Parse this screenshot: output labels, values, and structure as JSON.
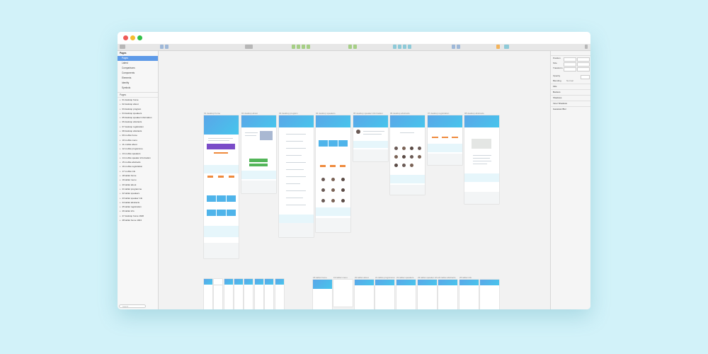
{
  "sidebar": {
    "pages_header": "Pages",
    "pages": [
      "Pages",
      "Latest",
      "Comparisons",
      "Components",
      "Elements",
      "Identity",
      "Symbols"
    ],
    "layers_header": "Pages",
    "layers": [
      "01 desktop home",
      "02 desktop about",
      "03 desktop program",
      "04 desktop speakers",
      "05 desktop speaker information",
      "06 desktop abstracts",
      "07 desktop registration",
      "08 desktop abstracts",
      "09 mobile home",
      "10 mobile menu",
      "11 mobile about",
      "12 mobile programme",
      "13 mobile speakers",
      "14 mobile speaker information",
      "15 mobile abstracts",
      "16 mobile registration",
      "17 mobile info",
      "18 tablet home",
      "19 tablet menu",
      "20 tablet about",
      "21 tablet programme",
      "22 tablet speakers",
      "23 tablet speaker info",
      "24 tablet abstracts",
      "25 tablet registration",
      "26 tablet info",
      "27 desktop home 1920",
      "28 tablet home 1024"
    ],
    "search_placeholder": "Search"
  },
  "artboards_top": [
    "01 desktop home",
    "02 desktop about",
    "03 desktop program",
    "04 desktop speakers",
    "05 desktop speaker information",
    "06 desktop abstracts",
    "07 desktop registration",
    "08 desktop abstracts"
  ],
  "artboards_bottom": [
    "18 tablet home",
    "19 tablet menu",
    "20 tablet about",
    "21 tablet programme",
    "22 tablet speakers",
    "23 tablet speaker info",
    "24 tablet abstracts",
    "26 tablet info"
  ],
  "inspector": {
    "position": "Position",
    "size": "Size",
    "transform": "Transform",
    "opacity": "Opacity",
    "blending": "Blending",
    "blending_value": "Normal",
    "sections": [
      "Fills",
      "Borders",
      "Shadows",
      "Inner Shadows",
      "Gaussian Blur"
    ]
  },
  "colors": {
    "hero": "#4fb4ea",
    "accent": "#ef8a3c",
    "green": "#53b559",
    "selection": "#5d9ae8"
  }
}
